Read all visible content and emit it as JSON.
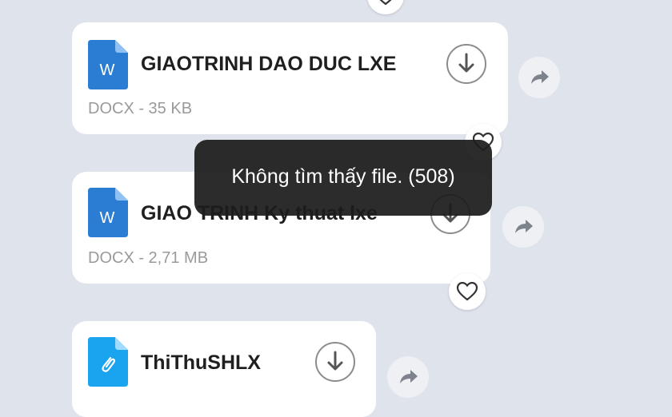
{
  "files": [
    {
      "name": "GIAOTRINH DAO DUC LXE",
      "meta": "DOCX - 35 KB",
      "icon": "word-doc-icon",
      "icon_letter": "W"
    },
    {
      "name": "GIAO TRINH Ky thuat lxe",
      "meta": "DOCX - 2,71 MB",
      "icon": "word-doc-icon",
      "icon_letter": "W"
    },
    {
      "name": "ThiThuSHLX",
      "meta": "",
      "icon": "attachment-file-icon"
    }
  ],
  "toast": {
    "message": "Không tìm thấy file. (508)"
  },
  "icons": {
    "download": "download-icon",
    "share": "share-arrow-icon",
    "react": "heart-icon"
  },
  "colors": {
    "background": "#dfe3ec",
    "card": "#ffffff",
    "word_blue": "#2b7cd3",
    "attachment_cyan": "#1aa3ee",
    "toast_bg": "#1c1c1c"
  }
}
